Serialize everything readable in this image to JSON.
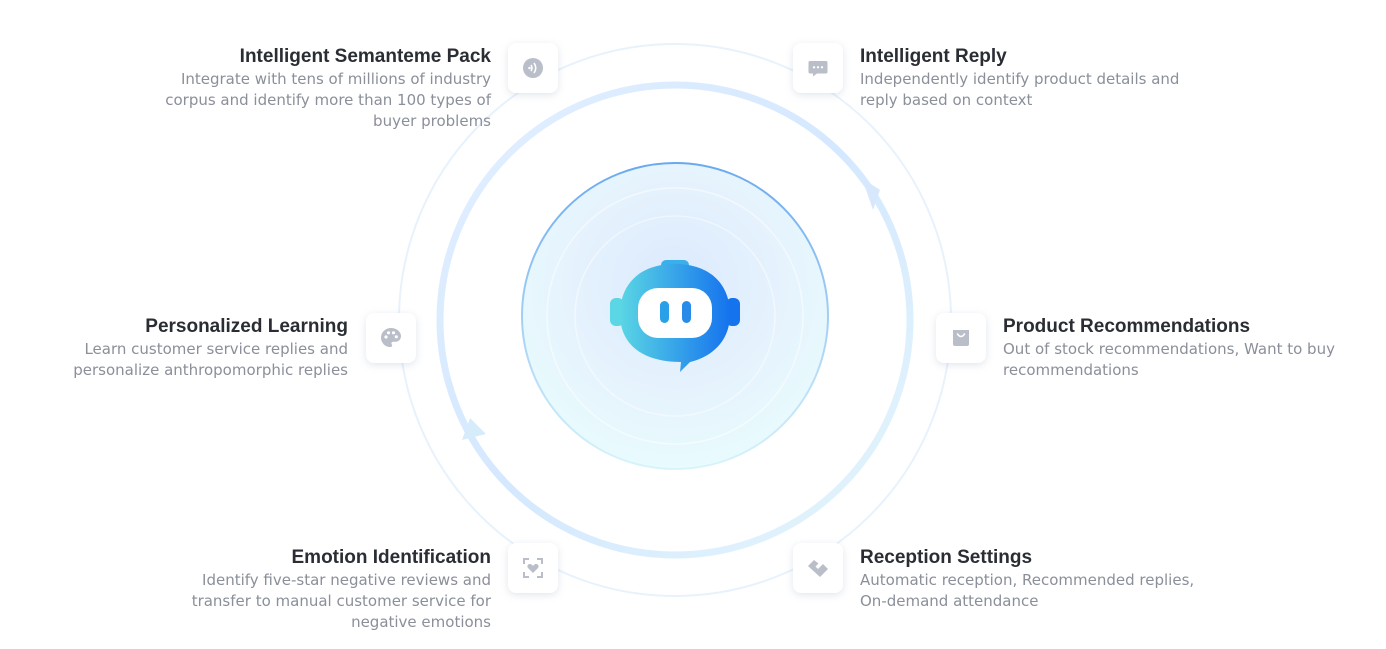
{
  "features": [
    {
      "title": "Intelligent Semanteme Pack",
      "desc": "Integrate with tens of millions of industry corpus and identify more than 100 types of buyer problems",
      "icon": "voice-icon"
    },
    {
      "title": "Intelligent Reply",
      "desc": "Independently identify product details and reply based on context",
      "icon": "chat-bubble-icon"
    },
    {
      "title": "Personalized Learning",
      "desc": "Learn customer service replies and personalize anthropomorphic replies",
      "icon": "palette-icon"
    },
    {
      "title": "Product Recommendations",
      "desc": "Out of stock recommendations, Want to buy recommendations",
      "icon": "shopping-bag-icon"
    },
    {
      "title": "Emotion Identification",
      "desc": "Identify five-star negative reviews and transfer to manual customer service for negative emotions",
      "icon": "heart-scan-icon"
    },
    {
      "title": "Reception Settings",
      "desc": "Automatic reception, Recommended replies, On-demand attendance",
      "icon": "handshake-icon"
    }
  ],
  "center": {
    "icon": "robot-chat-icon"
  },
  "colors": {
    "accent": "#1a7ef0",
    "accent_light": "#5ad0e6",
    "title": "#2a2d33",
    "desc": "#8a8f99",
    "icon_gray": "#b9bec8"
  }
}
